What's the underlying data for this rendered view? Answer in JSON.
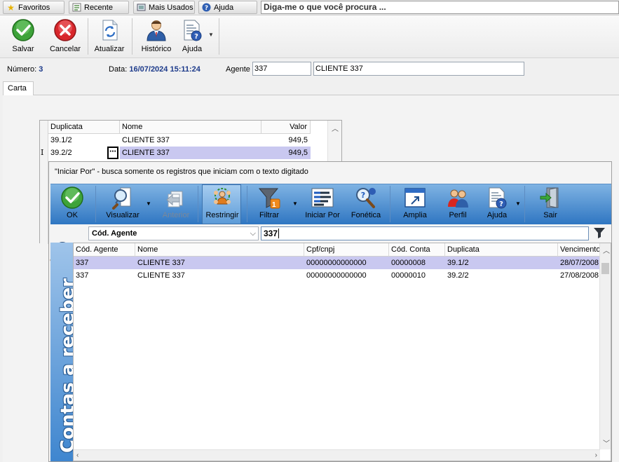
{
  "top_tabs": [
    {
      "label": "Favoritos",
      "icon": "star-icon"
    },
    {
      "label": "Recente",
      "icon": "recent-icon"
    },
    {
      "label": "Mais Usados",
      "icon": "most-used-icon"
    },
    {
      "label": "Ajuda",
      "icon": "help-icon"
    }
  ],
  "search": {
    "value": "Diga-me o que você procura ..."
  },
  "toolbar": {
    "save_label": "Salvar",
    "cancel_label": "Cancelar",
    "refresh_label": "Atualizar",
    "history_label": "Histórico",
    "help_label": "Ajuda"
  },
  "info": {
    "numero_label": "Número:",
    "numero_value": "3",
    "data_label": "Data:",
    "data_value": "16/07/2024 15:11:24",
    "agente_label": "Agente",
    "agente_code": "337",
    "agente_name": "CLIENTE 337"
  },
  "page_tab": "Carta",
  "small_grid": {
    "headers": [
      "Duplicata",
      "Nome",
      "Valor"
    ],
    "rows": [
      {
        "duplicata": "39.1/2",
        "nome": "CLIENTE 337",
        "valor": "949,5"
      },
      {
        "duplicata": "39.2/2",
        "nome": "CLIENTE 337",
        "valor": "949,5"
      }
    ]
  },
  "popup": {
    "title": "\"Iniciar Por\" - busca somente os registros que iniciam com o texto digitado",
    "toolbar": {
      "ok": "OK",
      "visualizar": "Visualizar",
      "anterior": "Anterior",
      "restringir": "Restringir",
      "filtrar": "Filtrar",
      "filtrar_badge": "1",
      "iniciar_por": "Iniciar Por",
      "fonetica": "Fonética",
      "amplia": "Amplia",
      "perfil": "Perfil",
      "ajuda": "Ajuda",
      "sair": "Sair"
    },
    "field_select": "Cód. Agente",
    "search_value": "337",
    "side_label": "Contas a receber",
    "grid": {
      "headers": [
        "Cód. Agente",
        "Nome",
        "Cpf/cnpj",
        "Cód. Conta",
        "Duplicata",
        "Vencimento"
      ],
      "rows": [
        {
          "cod_agente": "337",
          "nome": "CLIENTE 337",
          "cpf": "00000000000000",
          "cod_conta": "00000008",
          "duplicata": "39.1/2",
          "vencimento": "28/07/2008"
        },
        {
          "cod_agente": "337",
          "nome": "CLIENTE 337",
          "cpf": "00000000000000",
          "cod_conta": "00000010",
          "duplicata": "39.2/2",
          "vencimento": "27/08/2008"
        }
      ]
    }
  }
}
